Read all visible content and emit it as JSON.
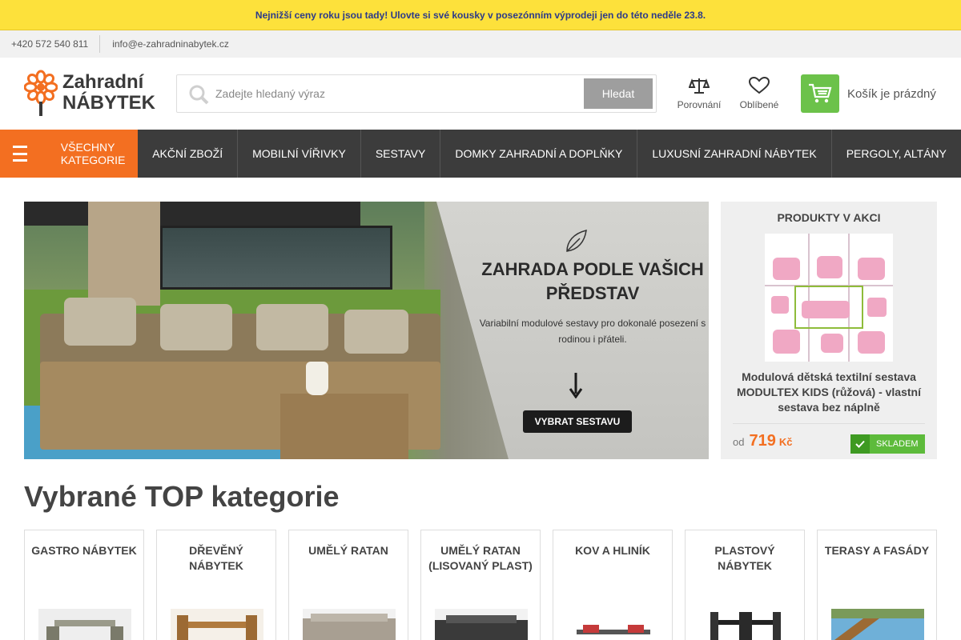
{
  "promo_bar": {
    "text": "Nejnižší ceny roku jsou tady! Ulovte si své kousky v posezónním výprodeji jen do této neděle 23.8."
  },
  "contact": {
    "phone": "+420 572 540 811",
    "email": "info@e-zahradninabytek.cz"
  },
  "logo": {
    "line1": "Zahradní",
    "line2": "NÁBYTEK"
  },
  "search": {
    "placeholder": "Zadejte hledaný výraz",
    "button_label": "Hledat"
  },
  "header_actions": {
    "compare_label": "Porovnání",
    "favorites_label": "Oblíbené"
  },
  "cart": {
    "label": "Košík je prázdný"
  },
  "nav": {
    "all_categories": "VŠECHNY KATEGORIE",
    "items": [
      {
        "label": "AKČNÍ ZBOŽÍ"
      },
      {
        "label": "MOBILNÍ VÍŘIVKY"
      },
      {
        "label": "SESTAVY"
      },
      {
        "label": "DOMKY ZAHRADNÍ A DOPLŇKY"
      },
      {
        "label": "LUXUSNÍ ZAHRADNÍ NÁBYTEK"
      },
      {
        "label": "PERGOLY, ALTÁNY"
      }
    ]
  },
  "hero": {
    "headline": "ZAHRADA PODLE VAŠICH PŘEDSTAV",
    "subline": "Variabilní modulové sestavy pro dokonalé posezení s rodinou i přáteli.",
    "cta_label": "VYBRAT SESTAVU"
  },
  "promo_products": {
    "title": "PRODUKTY V AKCI",
    "product_name": "Modulová dětská textilní sestava MODULTEX KIDS (růžová) - vlastní sestava bez náplně",
    "price_prefix": "od",
    "price_value": "719",
    "price_currency": "Kč",
    "stock_label": "SKLADEM"
  },
  "top_categories": {
    "title": "Vybrané TOP kategorie",
    "items": [
      {
        "label": "GASTRO NÁBYTEK"
      },
      {
        "label": "DŘEVĚNÝ NÁBYTEK"
      },
      {
        "label": "UMĚLÝ RATAN"
      },
      {
        "label": "UMĚLÝ RATAN (LISOVANÝ PLAST)"
      },
      {
        "label": "KOV A HLINÍK"
      },
      {
        "label": "PLASTOVÝ NÁBYTEK"
      },
      {
        "label": "TERASY A FASÁDY"
      }
    ]
  },
  "colors": {
    "accent_orange": "#f36f21",
    "promo_yellow": "#fde13b",
    "cart_green": "#6cc24a",
    "nav_dark": "#3c3c3c"
  }
}
